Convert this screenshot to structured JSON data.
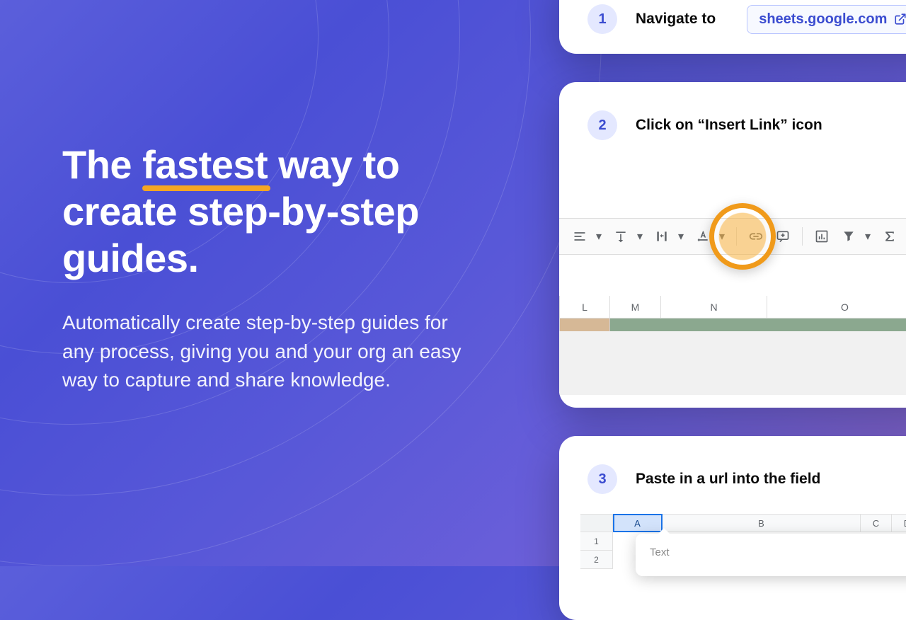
{
  "hero": {
    "headline_pre": "The ",
    "headline_underlined": "fastest",
    "headline_post": " way to create step-by-step guides.",
    "subhead": "Automatically create step-by-step guides for any process, giving you and your org an easy way to capture and share knowledge."
  },
  "steps": [
    {
      "num": "1",
      "text": "Navigate to",
      "url": "sheets.google.com"
    },
    {
      "num": "2",
      "text": "Click on “Insert Link” icon"
    },
    {
      "num": "3",
      "text": "Paste in a url into the field"
    }
  ],
  "sheet2": {
    "columns": [
      "L",
      "M",
      "N",
      "O"
    ]
  },
  "sheet3": {
    "columns": [
      "A",
      "B",
      "C",
      "D"
    ],
    "rows": [
      "1",
      "2"
    ],
    "popover_label": "Text"
  }
}
